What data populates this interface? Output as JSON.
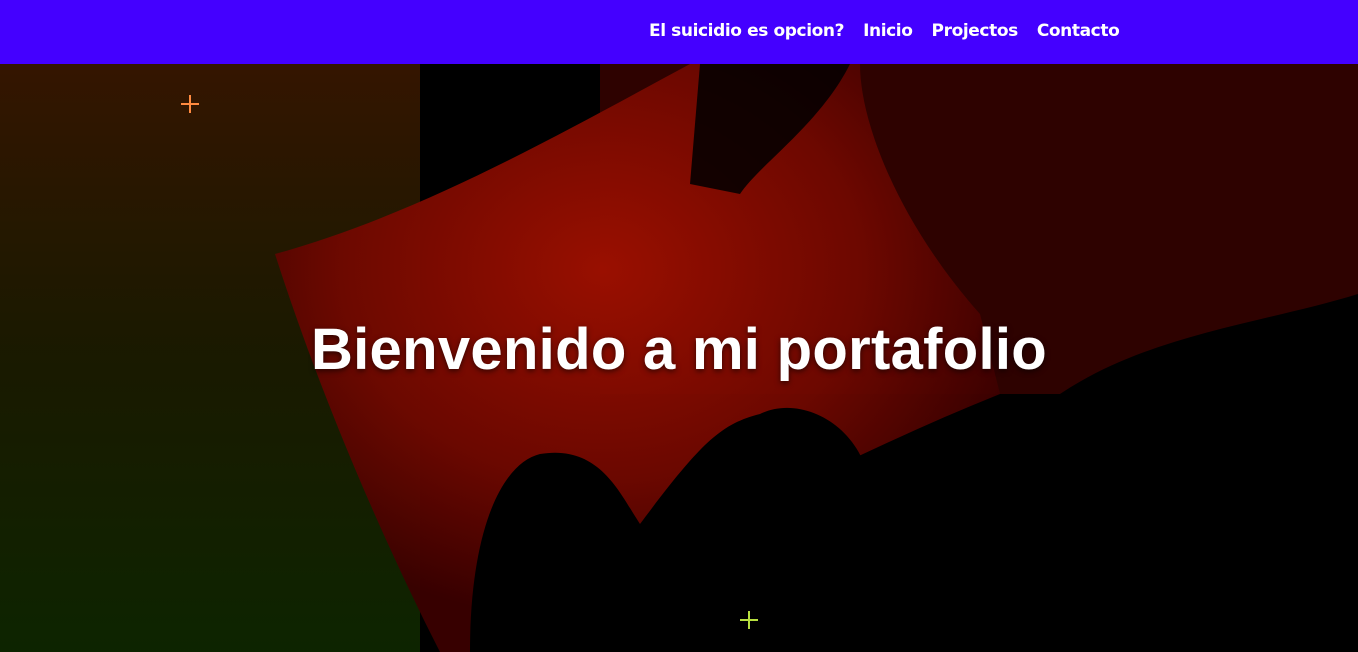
{
  "nav": {
    "items": [
      {
        "label": "El suicidio es opcion?"
      },
      {
        "label": "Inicio"
      },
      {
        "label": "Projectos"
      },
      {
        "label": "Contacto"
      }
    ]
  },
  "hero": {
    "title": "Bienvenido a mi portafolio"
  },
  "colors": {
    "navbar_bg": "#4400ff",
    "hero_bg": "#000000",
    "line_red": "#ff2a10",
    "line_orange": "#ff8c00",
    "line_yellow": "#d8e040",
    "line_green": "#7ac000"
  }
}
